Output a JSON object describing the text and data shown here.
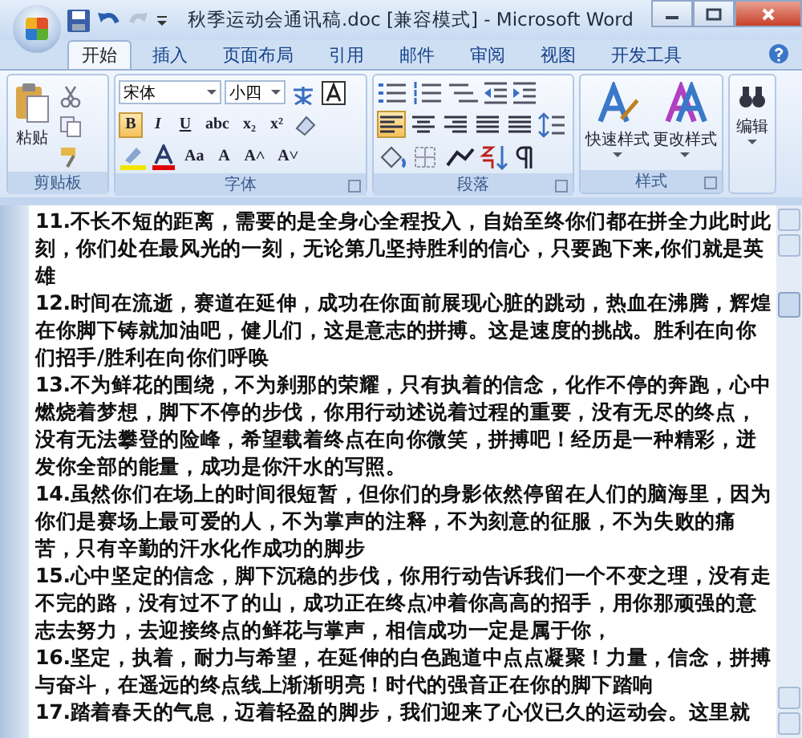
{
  "window": {
    "title": "秋季运动会通讯稿.doc [兼容模式] - Microsoft Word"
  },
  "tabs": [
    {
      "label": "开始",
      "selected": true
    },
    {
      "label": "插入",
      "selected": false
    },
    {
      "label": "页面布局",
      "selected": false
    },
    {
      "label": "引用",
      "selected": false
    },
    {
      "label": "邮件",
      "selected": false
    },
    {
      "label": "审阅",
      "selected": false
    },
    {
      "label": "视图",
      "selected": false
    },
    {
      "label": "开发工具",
      "selected": false
    }
  ],
  "clipboard": {
    "label": "剪贴板",
    "paste": "粘贴"
  },
  "font": {
    "label": "字体",
    "name": "宋体",
    "size": "小四",
    "format_buttons": [
      {
        "label": "B",
        "selected": true
      },
      {
        "label": "I",
        "selected": false
      },
      {
        "label": "U",
        "selected": false
      },
      {
        "label": "abc",
        "selected": false
      },
      {
        "label": "x₂",
        "selected": false
      },
      {
        "label": "x²",
        "selected": false
      }
    ],
    "effect_buttons": [
      "Aa",
      "A",
      "A˄",
      "A˅"
    ]
  },
  "paragraph": {
    "label": "段落",
    "alignments": [
      {
        "selected": true
      },
      {
        "selected": false
      },
      {
        "selected": false
      },
      {
        "selected": false
      },
      {
        "selected": false
      }
    ]
  },
  "styles": {
    "label": "样式",
    "buttons": [
      "快速样式",
      "更改样式"
    ]
  },
  "editing": {
    "label": "编辑"
  },
  "document": {
    "paragraphs": [
      "11.不长不短的距离，需要的是全身心全程投入，自始至终你们都在拼全力此时此刻，你们处在最风光的一刻，无论第几坚持胜利的信心，只要跑下来,你们就是英雄",
      "12.时间在流逝，赛道在延伸，成功在你面前展现心脏的跳动，热血在沸腾，辉煌在你脚下铸就加油吧，健儿们，这是意志的拼搏。这是速度的挑战。胜利在向你们招手/胜利在向你们呼唤",
      "13.不为鲜花的围绕，不为刹那的荣耀，只有执着的信念，化作不停的奔跑，心中燃烧着梦想，脚下不停的步伐，你用行动述说着过程的重要，没有无尽的终点，没有无法攀登的险峰，希望载着终点在向你微笑，拼搏吧！经历是一种精彩，迸发你全部的能量，成功是你汗水的写照。",
      "14.虽然你们在场上的时间很短暂，但你们的身影依然停留在人们的脑海里，因为你们是赛场上最可爱的人，不为掌声的注释，不为刻意的征服，不为失败的痛苦，只有辛勤的汗水化作成功的脚步",
      "15.心中坚定的信念，脚下沉稳的步伐，你用行动告诉我们一个不变之理，没有走不完的路，没有过不了的山，成功正在终点冲着你高高的招手，用你那顽强的意志去努力，去迎接终点的鲜花与掌声，相信成功一定是属于你，",
      "16.坚定，执着，耐力与希望，在延伸的白色跑道中点点凝聚！力量，信念，拼搏与奋斗，在遥远的终点线上渐渐明亮！时代的强音正在你的脚下踏响",
      "17.踏着春天的气息，迈着轻盈的脚步，我们迎来了心仪已久的运动会。这里就"
    ]
  }
}
